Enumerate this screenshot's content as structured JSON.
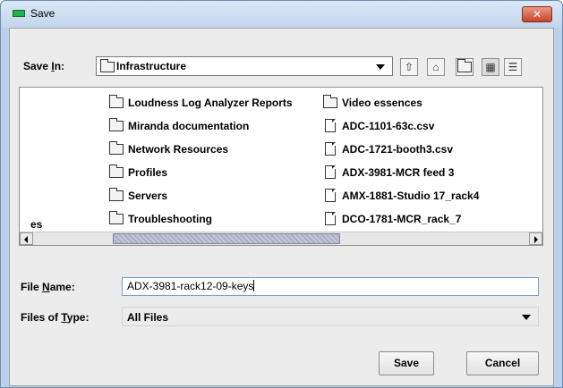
{
  "window": {
    "title": "Save",
    "close_symbol": "✕"
  },
  "save_in": {
    "label_prefix": "Save ",
    "label_mnemonic": "I",
    "label_suffix": "n:",
    "value": "Infrastructure"
  },
  "toolbar": {
    "icons": [
      "up-one-level-icon",
      "home-icon",
      "new-folder-icon",
      "list-view-icon",
      "details-view-icon"
    ]
  },
  "file_list": {
    "partial_entry": "es",
    "folders": [
      "Loudness Log Analyzer Reports",
      "Miranda documentation",
      "Network Resources",
      "Profiles",
      "Servers",
      "Troubleshooting"
    ],
    "column2": [
      {
        "name": "Video essences",
        "kind": "folder"
      },
      {
        "name": "ADC-1101-63c.csv",
        "kind": "file"
      },
      {
        "name": "ADC-1721-booth3.csv",
        "kind": "file"
      },
      {
        "name": "ADX-3981-MCR feed 3",
        "kind": "file"
      },
      {
        "name": "AMX-1881-Studio 17_rack4",
        "kind": "file"
      },
      {
        "name": "DCO-1781-MCR_rack_7",
        "kind": "file"
      }
    ]
  },
  "file_name": {
    "label_prefix": "File ",
    "label_mnemonic": "N",
    "label_suffix": "ame:",
    "value": "ADX-3981-rack12-09-keys"
  },
  "file_type": {
    "label_prefix": "Files of ",
    "label_mnemonic": "T",
    "label_suffix": "ype:",
    "value": "All Files"
  },
  "buttons": {
    "save": "Save",
    "cancel": "Cancel"
  }
}
